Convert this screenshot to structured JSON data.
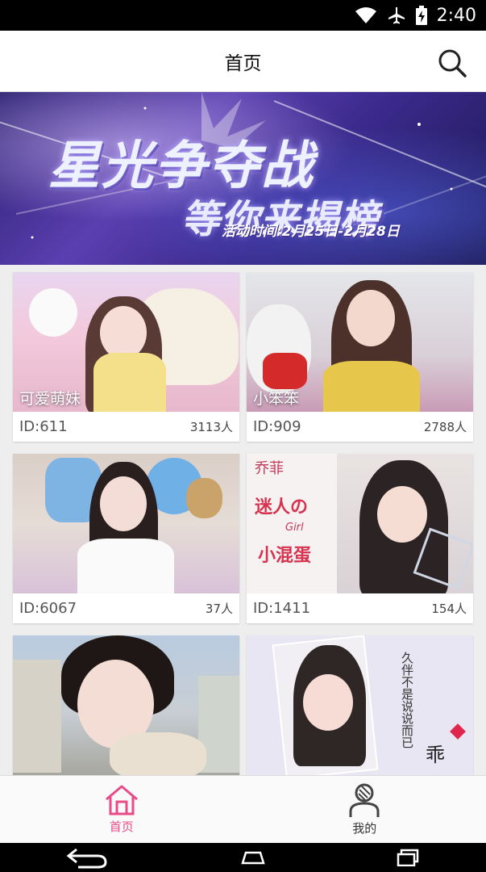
{
  "status_bar": {
    "time": "2:40",
    "icons": [
      "wifi-icon",
      "airplane-mode-icon",
      "battery-charging-icon"
    ]
  },
  "header": {
    "title": "首页",
    "search_icon": "search-icon"
  },
  "banner": {
    "headline": "星光争夺战",
    "subline": "等你来揭榜",
    "date_text": "活动时间:2月25日-2月28日"
  },
  "rooms": [
    {
      "name": "可爱萌妹",
      "id_label": "ID:611",
      "viewers": "3113人"
    },
    {
      "name": "小笨笨",
      "id_label": "ID:909",
      "viewers": "2788人"
    },
    {
      "name": "",
      "id_label": "ID:6067",
      "viewers": "37人"
    },
    {
      "name": "",
      "id_label": "ID:1411",
      "viewers": "154人"
    },
    {
      "name": "",
      "id_label": "",
      "viewers": ""
    },
    {
      "name": "",
      "id_label": "",
      "viewers": ""
    }
  ],
  "thumb_overlay_text": {
    "card4": [
      "乔菲",
      "迷人の",
      "Girl",
      "小混蛋"
    ],
    "card6": [
      "久伴不是说说而已",
      "乖"
    ]
  },
  "bottom_nav": {
    "items": [
      {
        "label": "首页",
        "icon": "home-icon",
        "active": true
      },
      {
        "label": "我的",
        "icon": "profile-icon",
        "active": false
      }
    ]
  },
  "colors": {
    "accent": "#e84c88",
    "status_bar": "#000000",
    "app_bar": "#ffffff",
    "page_bg": "#eeeeee"
  }
}
